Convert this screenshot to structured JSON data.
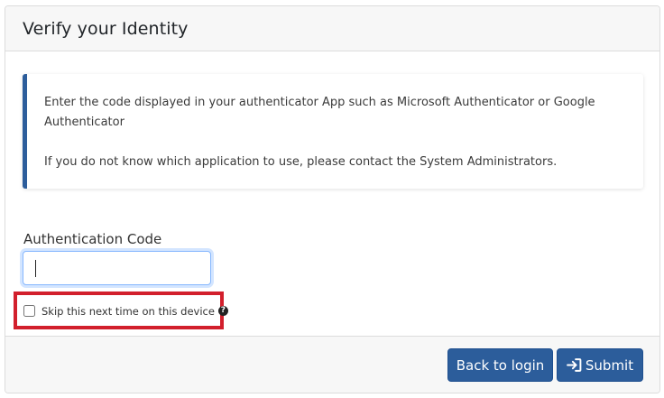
{
  "header": {
    "title": "Verify your Identity"
  },
  "info": {
    "line1": "Enter the code displayed in your authenticator App such as Microsoft Authenticator or Google Authenticator",
    "line2": "If you do not know which application to use, please contact the System Administrators."
  },
  "form": {
    "code_label": "Authentication Code",
    "code_value": "",
    "skip_label": "Skip this next time on this device",
    "skip_checked": false,
    "help_icon": "question-circle-icon"
  },
  "footer": {
    "back_label": "Back to login",
    "submit_label": "Submit",
    "submit_icon": "sign-in-icon"
  },
  "colors": {
    "primary": "#2c5d9b",
    "highlight": "#d21f2c"
  }
}
